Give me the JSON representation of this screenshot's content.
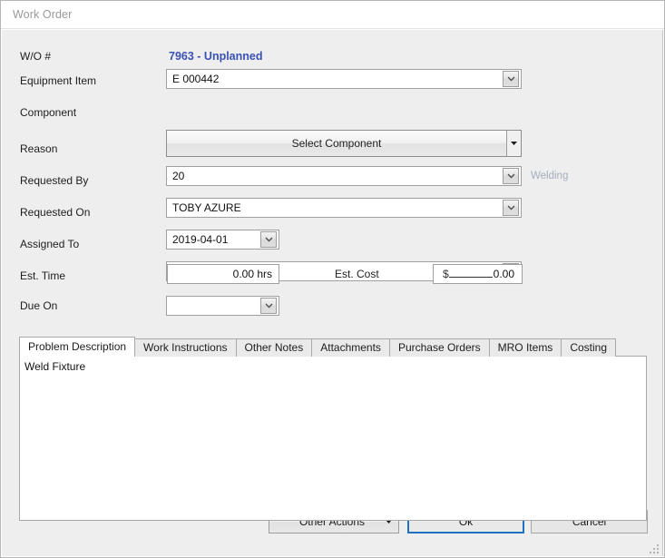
{
  "window": {
    "title": "Work Order"
  },
  "form": {
    "fields": {
      "wo_number": {
        "label": "W/O #",
        "value": "7963 - Unplanned"
      },
      "equipment_item": {
        "label": "Equipment Item",
        "value": "E 000442"
      },
      "component": {
        "label": "Component",
        "button_label": "Select Component"
      },
      "reason": {
        "label": "Reason",
        "value": "20",
        "note": "Welding"
      },
      "requested_by": {
        "label": "Requested By",
        "value": "TOBY AZURE"
      },
      "requested_on": {
        "label": "Requested On",
        "value": "2019-04-01"
      },
      "assigned_to": {
        "label": "Assigned To",
        "value": ""
      },
      "est_time": {
        "label": "Est. Time",
        "value": "0.00 hrs"
      },
      "est_cost": {
        "label": "Est. Cost",
        "currency": "$",
        "amount": "0.00"
      },
      "due_on": {
        "label": "Due On",
        "value": ""
      }
    }
  },
  "tabs": {
    "items": [
      {
        "label": "Problem Description",
        "active": true
      },
      {
        "label": "Work Instructions",
        "active": false
      },
      {
        "label": "Other Notes",
        "active": false
      },
      {
        "label": "Attachments",
        "active": false
      },
      {
        "label": "Purchase Orders",
        "active": false
      },
      {
        "label": "MRO Items",
        "active": false
      },
      {
        "label": "Costing",
        "active": false
      }
    ],
    "active_content": "Weld Fixture"
  },
  "buttons": {
    "other_actions": "Other Actions",
    "ok": "Ok",
    "cancel": "Cancel"
  },
  "colors": {
    "accent_blue": "#3a51b4",
    "focus_blue": "#1f72bd",
    "note_grey": "#a4aebd",
    "panel_bg": "#eeeeee"
  },
  "icons": {
    "chevron_down": "chevron-down-icon",
    "caret_down": "caret-down-icon",
    "resize_grip": "resize-grip-icon"
  }
}
